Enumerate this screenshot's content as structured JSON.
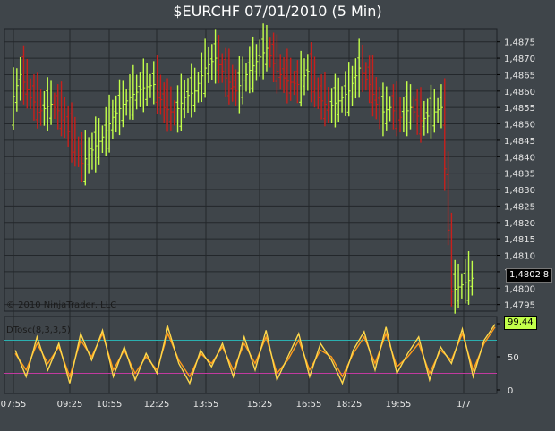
{
  "title": "$EURCHF  07/01/2010 (5 Min)",
  "copyright": "© 2010 NinjaTrader, LLC",
  "indicator_label": "DTosc(8,3,3,5)",
  "last_price_label": "1,4802'8",
  "osc_value_label": "99,44",
  "colors": {
    "background": "#3f454a",
    "grid": "#23272b",
    "up": "#c2ff4a",
    "down": "#c8201c",
    "osc_fast": "#ffd84a",
    "osc_slow": "#ff9a1a",
    "level_high": "#2bb0b0",
    "level_low": "#c23aa0"
  },
  "price_axis": {
    "ticks": [
      "1,4875",
      "1,4870",
      "1,4865",
      "1,4860",
      "1,4855",
      "1,4850",
      "1,4845",
      "1,4840",
      "1,4835",
      "1,4830",
      "1,4825",
      "1,4820",
      "1,4815",
      "1,4810",
      "1,4805",
      "1,4800",
      "1,4795"
    ]
  },
  "osc_axis": {
    "ticks": [
      "100",
      "50",
      "0"
    ]
  },
  "time_axis": {
    "ticks": [
      "07:55",
      "09:25",
      "10:55",
      "12:25",
      "13:55",
      "15:25",
      "16:55",
      "18:25",
      "19:55",
      "1/7"
    ]
  },
  "chart_data": [
    {
      "type": "ohlc",
      "title": "$EURCHF  07/01/2010 (5 Min)",
      "ylim": [
        1.4793,
        1.4879
      ],
      "x": [
        "07:55",
        "09:25",
        "10:55",
        "12:25",
        "13:55",
        "15:25",
        "16:55",
        "18:25",
        "19:55",
        "1/7"
      ],
      "series": [
        {
          "name": "close",
          "points": [
            [
              0,
              1.4855
            ],
            [
              3,
              1.4865
            ],
            [
              6,
              1.4858
            ],
            [
              9,
              1.4854
            ],
            [
              12,
              1.4856
            ],
            [
              15,
              1.4853
            ],
            [
              18,
              1.4845
            ],
            [
              21,
              1.4838
            ],
            [
              24,
              1.4842
            ],
            [
              27,
              1.4846
            ],
            [
              30,
              1.4852
            ],
            [
              33,
              1.4856
            ],
            [
              36,
              1.4859
            ],
            [
              39,
              1.4861
            ],
            [
              42,
              1.4862
            ],
            [
              45,
              1.4855
            ],
            [
              48,
              1.4853
            ],
            [
              51,
              1.4858
            ],
            [
              54,
              1.486
            ],
            [
              57,
              1.4867
            ],
            [
              60,
              1.487
            ],
            [
              63,
              1.4864
            ],
            [
              66,
              1.486
            ],
            [
              69,
              1.4865
            ],
            [
              72,
              1.4869
            ],
            [
              75,
              1.4873
            ],
            [
              78,
              1.4866
            ],
            [
              81,
              1.4863
            ],
            [
              84,
              1.4862
            ],
            [
              87,
              1.4866
            ],
            [
              90,
              1.4858
            ],
            [
              93,
              1.4855
            ],
            [
              96,
              1.4857
            ],
            [
              99,
              1.486
            ],
            [
              102,
              1.4867
            ],
            [
              105,
              1.4862
            ],
            [
              108,
              1.4853
            ],
            [
              111,
              1.4855
            ],
            [
              114,
              1.4852
            ],
            [
              117,
              1.4855
            ],
            [
              120,
              1.4851
            ],
            [
              123,
              1.4853
            ],
            [
              126,
              1.4855
            ],
            [
              129,
              1.4799
            ],
            [
              132,
              1.4801
            ],
            [
              135,
              1.4803
            ]
          ]
        }
      ]
    },
    {
      "type": "line",
      "title": "DTosc(8,3,3,5)",
      "ylim": [
        0,
        100
      ],
      "levels": [
        75,
        25
      ],
      "series": [
        {
          "name": "fast",
          "values": [
            60,
            20,
            80,
            30,
            70,
            10,
            85,
            45,
            90,
            20,
            65,
            15,
            55,
            25,
            95,
            40,
            10,
            60,
            35,
            70,
            20,
            80,
            30,
            90,
            15,
            50,
            85,
            20,
            70,
            45,
            10,
            60,
            88,
            30,
            95,
            25,
            55,
            80,
            15,
            65,
            40,
            92,
            20,
            75,
            99
          ]
        },
        {
          "name": "slow",
          "values": [
            55,
            30,
            70,
            40,
            65,
            20,
            75,
            50,
            85,
            30,
            60,
            25,
            50,
            30,
            85,
            45,
            20,
            55,
            40,
            65,
            30,
            70,
            40,
            80,
            25,
            45,
            75,
            30,
            60,
            50,
            20,
            55,
            80,
            40,
            85,
            35,
            50,
            70,
            25,
            60,
            45,
            85,
            30,
            70,
            95
          ]
        }
      ]
    }
  ]
}
